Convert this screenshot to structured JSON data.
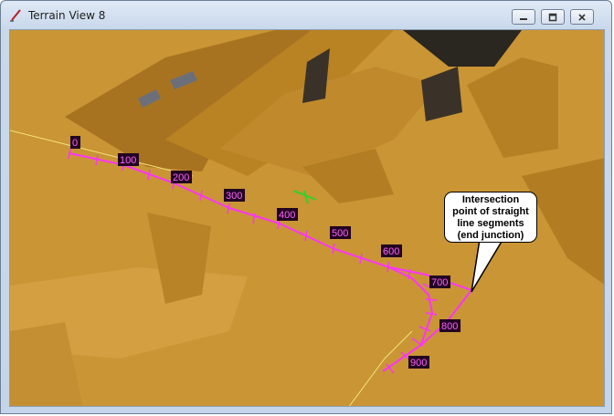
{
  "window": {
    "title": "Terrain View 8",
    "icon": "pencil-ruler-icon"
  },
  "controls": {
    "minimize_icon": "minimize-icon",
    "maximize_icon": "restore-icon",
    "close_icon": "close-icon"
  },
  "viewport": {
    "terrain_color": "#c99535",
    "path_color": "#ff33ff",
    "label_bg": "#220022",
    "path_labels": [
      "0",
      "100",
      "200",
      "300",
      "400",
      "500",
      "600",
      "700",
      "800",
      "900"
    ]
  },
  "callout": {
    "lines": [
      "Intersection",
      "point of straight",
      "line segments",
      "(end junction)"
    ]
  }
}
